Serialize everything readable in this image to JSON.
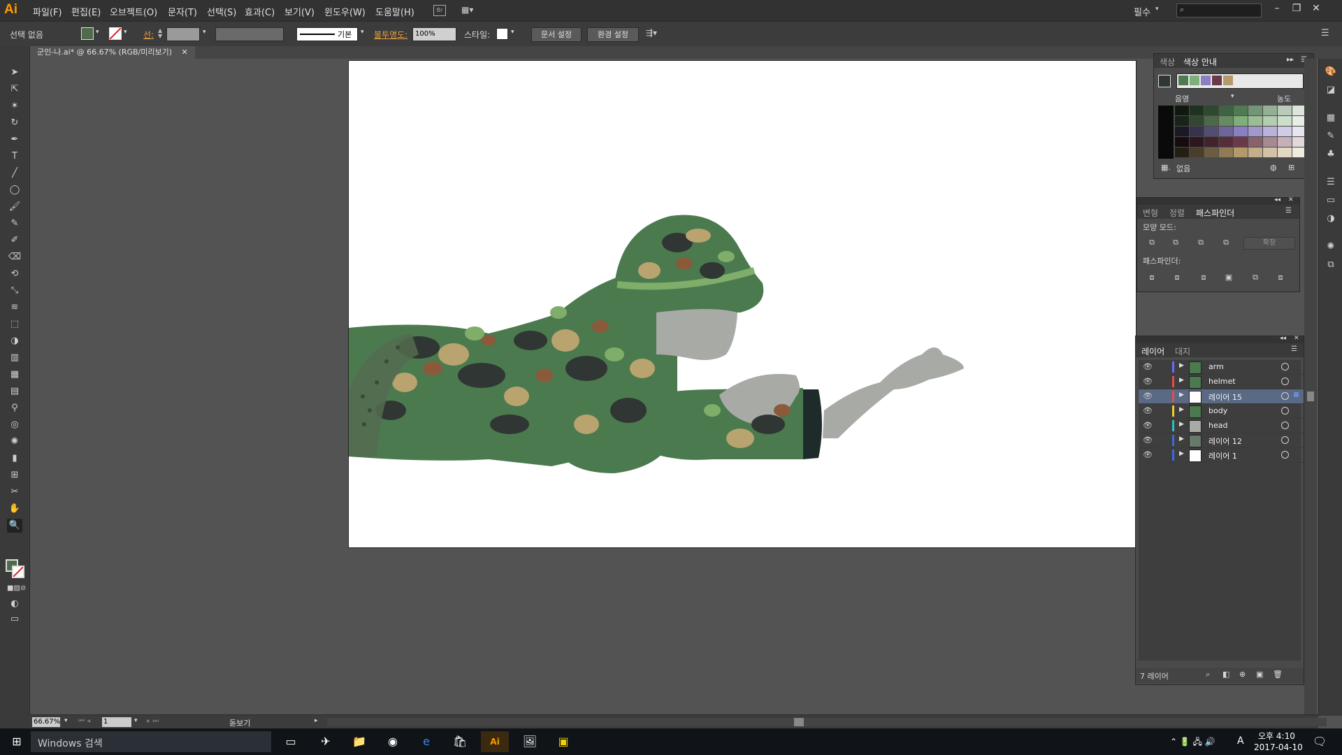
{
  "app": {
    "logo": "Ai"
  },
  "menu": {
    "items": [
      "파일(F)",
      "편집(E)",
      "오브젝트(O)",
      "문자(T)",
      "선택(S)",
      "효과(C)",
      "보기(V)",
      "윈도우(W)",
      "도움말(H)"
    ],
    "workspace": "필수",
    "search_placeholder": ""
  },
  "control": {
    "selection": "선택 없음",
    "stroke_label": "선:",
    "stroke_style": "기본",
    "opacity_label": "불투명도:",
    "opacity_value": "100%",
    "style_label": "스타일:",
    "doc_setup": "문서 설정",
    "preferences": "환경 설정"
  },
  "document": {
    "tab_title": "군인-나.ai* @ 66.67% (RGB/미리보기)"
  },
  "panels": {
    "color": {
      "tab1": "색상",
      "tab2": "색상 안내",
      "left_label": "음영",
      "right_label": "농도",
      "none_label": "없음",
      "accent_colors": [
        "#4f7a52",
        "#7fae7a",
        "#8a7fc0",
        "#6b3a48",
        "#b49a6a"
      ]
    },
    "pathfinder": {
      "tab1": "변형",
      "tab2": "정렬",
      "tab3": "패스파인더",
      "shape_modes": "모양 모드:",
      "pathfinders": "패스파인더:",
      "expand": "확장"
    },
    "layers": {
      "tab1": "레이어",
      "tab2": "대지",
      "items": [
        {
          "name": "arm",
          "color": "#6a6aff"
        },
        {
          "name": "helmet",
          "color": "#e84b4b"
        },
        {
          "name": "레이어 15",
          "color": "#e84b4b"
        },
        {
          "name": "body",
          "color": "#f0d020"
        },
        {
          "name": "head",
          "color": "#30c0c0"
        },
        {
          "name": "레이어 12",
          "color": "#3a6ae0"
        },
        {
          "name": "레이어 1",
          "color": "#3a6ae0"
        }
      ],
      "footer": "7 레이어"
    }
  },
  "status": {
    "zoom": "66.67%",
    "page": "1",
    "tool_name": "돋보기"
  },
  "taskbar": {
    "search_placeholder": "Windows 검색",
    "time": "오후 4:10",
    "date": "2017-04-10",
    "ime": "A"
  }
}
